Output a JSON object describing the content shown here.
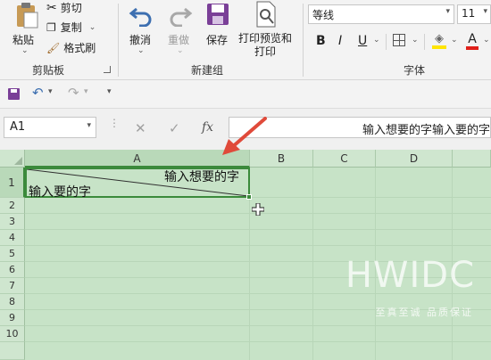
{
  "ribbon": {
    "clipboard": {
      "paste_label": "粘贴",
      "cut_label": "剪切",
      "copy_label": "复制",
      "format_painter_label": "格式刷",
      "group_label": "剪贴板"
    },
    "new_group": {
      "undo_label": "撤消",
      "redo_label": "重做",
      "save_label": "保存",
      "print_preview_label_1": "打印预览和",
      "print_preview_label_2": "打印",
      "group_label": "新建组"
    },
    "font": {
      "font_name": "等线",
      "font_size": "11",
      "bold": "B",
      "italic": "I",
      "underline": "U",
      "font_color_letter": "A",
      "group_label": "字体"
    }
  },
  "formula_bar": {
    "name_box": "A1",
    "fx_label": "fx",
    "content": "输入想要的字输入要的字"
  },
  "sheet": {
    "columns": [
      "A",
      "B",
      "C",
      "D"
    ],
    "rows": [
      "1",
      "2",
      "3",
      "4",
      "5",
      "6",
      "7",
      "8",
      "9",
      "10"
    ],
    "a1_top_right": "输入想要的字",
    "a1_bottom_left": "输入要的字"
  },
  "watermark": {
    "title": "HWIDC",
    "subtitle": "至真至诚 品质保证"
  },
  "colors": {
    "grid_background": "#c7e3c7",
    "arrow": "#e04a3a",
    "selection_border": "#3b8a3b"
  }
}
